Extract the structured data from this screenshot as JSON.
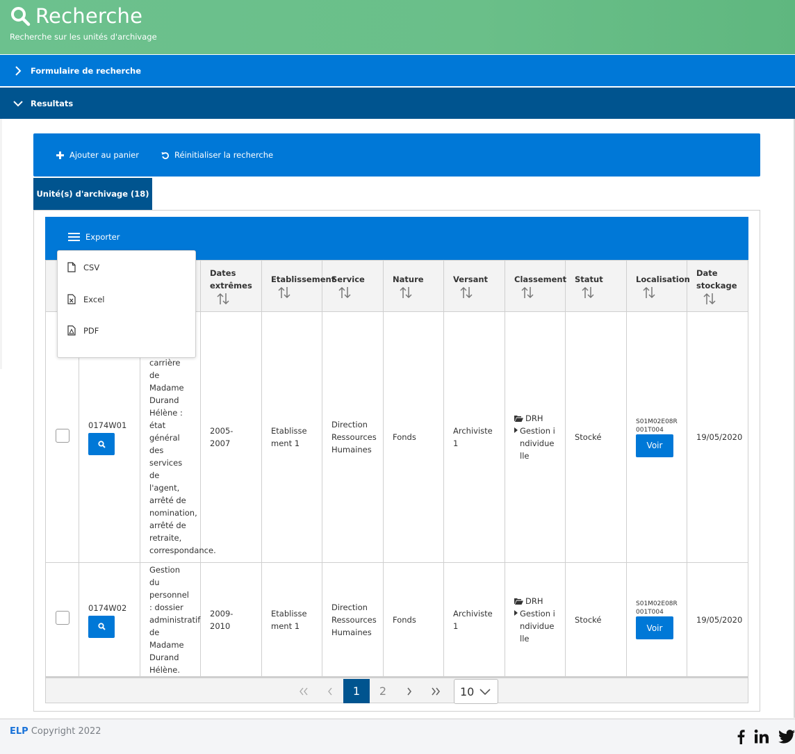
{
  "header": {
    "title": "Recherche",
    "subtitle": "Recherche sur les unités d'archivage",
    "icon": "search-icon"
  },
  "accordions": {
    "form": {
      "label": "Formulaire de recherche",
      "state": "collapsed"
    },
    "results": {
      "label": "Resultats",
      "state": "expanded"
    }
  },
  "toolbar": {
    "add_to_cart_label": "Ajouter au panier",
    "reset_search_label": "Réinitialiser la recherche"
  },
  "tab": {
    "label": "Unité(s) d'archivage (18)"
  },
  "grid": {
    "export_label": "Exporter",
    "export_menu": [
      {
        "label": "CSV",
        "icon": "file-icon"
      },
      {
        "label": "Excel",
        "icon": "file-excel-icon"
      },
      {
        "label": "PDF",
        "icon": "file-pdf-icon"
      }
    ],
    "columns": [
      {
        "label": ""
      },
      {
        "label": ""
      },
      {
        "label": ""
      },
      {
        "label": "Dates extrêmes",
        "sortable": true
      },
      {
        "label": "Etablissement",
        "sortable": true
      },
      {
        "label": "Service",
        "sortable": true
      },
      {
        "label": "Nature",
        "sortable": true
      },
      {
        "label": "Versant",
        "sortable": true
      },
      {
        "label": "Classement",
        "sortable": true
      },
      {
        "label": "Statut",
        "sortable": true
      },
      {
        "label": "Localisation",
        "sortable": true
      },
      {
        "label": "Date stockage",
        "sortable": true
      }
    ],
    "rows": [
      {
        "checked": false,
        "cote": "0174W01",
        "description": "de carrière de Madame Durand Hélène : état général des services de l'agent, arrêté de nomination, arrêté de retraite, correspondance.",
        "dates": "2005-2007",
        "etablissement": "Etablissement 1",
        "service": "Direction Ressources Humaines",
        "nature": "Fonds",
        "versant": "Archiviste 1",
        "classement_root": "DRH",
        "classement_child": "Gestion individuelle",
        "statut": "Stocké",
        "localisation": "S01M02E08R001T004",
        "voir_label": "Voir",
        "date_stockage": "19/05/2020"
      },
      {
        "checked": false,
        "cote": "0174W02",
        "description": "Gestion du personnel : dossier administratif de Madame Durand Hélène.",
        "dates": "2009-2010",
        "etablissement": "Etablissement 1",
        "service": "Direction Ressources Humaines",
        "nature": "Fonds",
        "versant": "Archiviste 1",
        "classement_root": "DRH",
        "classement_child": "Gestion individuelle",
        "statut": "Stocké",
        "localisation": "S01M02E08R001T004",
        "voir_label": "Voir",
        "date_stockage": "19/05/2020"
      }
    ]
  },
  "pagination": {
    "pages": [
      "1",
      "2"
    ],
    "current_page": "1",
    "page_size": "10"
  },
  "footer": {
    "brand": "ELP",
    "copyright": "Copyright 2022",
    "social": [
      "facebook-icon",
      "linkedin-icon",
      "twitter-icon"
    ]
  },
  "colors": {
    "header_green": "#6abf89",
    "primary_blue": "#0078d7",
    "dark_blue": "#00548f",
    "footer_bg": "#f4f5f7"
  }
}
